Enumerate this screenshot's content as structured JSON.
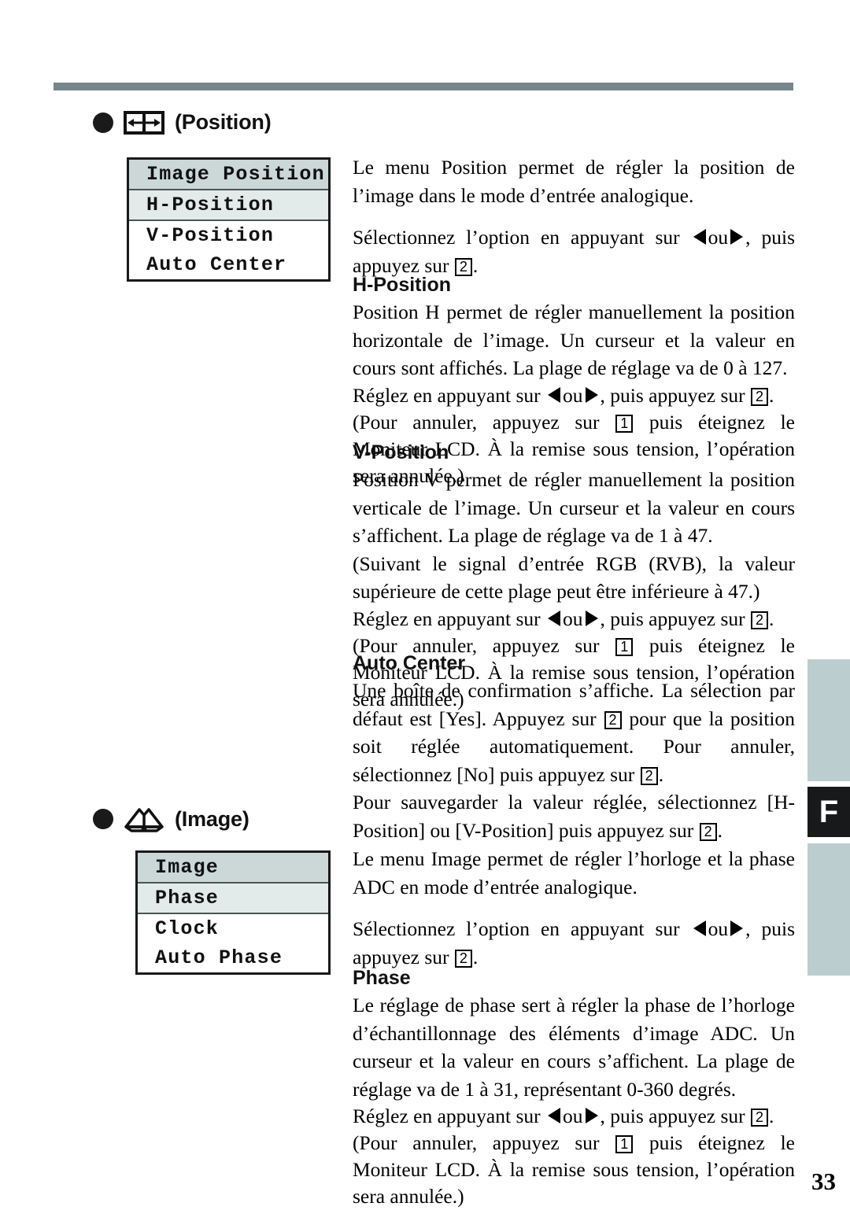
{
  "page": {
    "number": "33",
    "tab_letter": "F",
    "rule_color": "#76868a",
    "tab_color": "#bccdcf",
    "tab_active_color": "#17191b"
  },
  "sections": [
    {
      "icon": "position-icon",
      "heading": "(Position)",
      "osd": {
        "rows": [
          {
            "label": "Image Position",
            "state": "title"
          },
          {
            "label": "H-Position",
            "state": "selected"
          },
          {
            "label": "V-Position",
            "state": "normal"
          },
          {
            "label": "Auto Center",
            "state": "normal"
          }
        ]
      },
      "intro": [
        "Le menu Position permet de régler la position de l’image dans le mode d’entrée analogique.",
        "Sélectionnez l’option en appuyant sur "
      ],
      "intro_tail": ", puis appuyez sur ",
      "subsections": [
        {
          "title": "H-Position",
          "body": "Position H permet de régler manuellement la position horizontale de l’image. Un curseur et la valeur en cours sont affichés. La plage de réglage va de 0 à 127.",
          "adjust_lead": "Réglez en appuyant sur ",
          "adjust_mid": ",  puis appuyez sur ",
          "cancel_lead": "(Pour annuler, appuyez sur ",
          "cancel_tail": " puis éteignez le Moniteur LCD. À la remise sous tension, l’opération sera annulée.)"
        },
        {
          "title": "V-Position",
          "body": "Position V permet de régler manuellement la position verticale de l’image. Un curseur et la valeur en cours s’affichent. La plage de réglage va de 1 à 47.",
          "note": "(Suivant le signal d’entrée RGB (RVB), la valeur supérieure de cette plage peut être inférieure à 47.)",
          "adjust_lead": "Réglez en appuyant sur ",
          "adjust_mid": ",  puis appuyez sur ",
          "cancel_lead": "(Pour annuler, appuyez sur ",
          "cancel_tail": " puis éteignez le Moniteur LCD. À la remise sous tension, l’opération sera annulée.)"
        },
        {
          "title": "Auto Center",
          "body_a": "Une boîte de confirmation s’affiche. La sélection par défaut est [Yes]. Appuyez sur ",
          "body_b": " pour que la position soit réglée automatiquement. Pour annuler, sélectionnez [No] puis appuyez sur ",
          "body_c": ".",
          "save_a": "Pour sauvegarder la valeur réglée, sélectionnez [H-Position] ou [V-Position] puis appuyez sur ",
          "save_b": "."
        }
      ]
    },
    {
      "icon": "image-icon",
      "heading": "(Image)",
      "osd": {
        "rows": [
          {
            "label": "Image",
            "state": "title"
          },
          {
            "label": "Phase",
            "state": "selected"
          },
          {
            "label": "Clock",
            "state": "normal"
          },
          {
            "label": "Auto Phase",
            "state": "normal"
          }
        ]
      },
      "intro": [
        "Le menu Image permet de régler l’horloge et la phase ADC en mode d’entrée analogique.",
        "Sélectionnez l’option en appuyant sur "
      ],
      "intro_tail": ",  puis appuyez sur ",
      "subsections": [
        {
          "title": "Phase",
          "body": "Le réglage de phase sert à régler la phase de l’horloge d’échantillonnage des éléments d’image ADC. Un curseur et la valeur en cours s’affichent. La plage de réglage va de 1 à 31, représentant 0-360 degrés.",
          "adjust_lead": "Réglez en appuyant sur ",
          "adjust_mid": ",  puis appuyez sur ",
          "cancel_lead": "(Pour annuler, appuyez sur ",
          "cancel_tail": " puis éteignez le Moniteur LCD. À la remise sous tension, l’opération sera annulée.)"
        }
      ]
    }
  ],
  "keys": {
    "enter": "2",
    "escape": "1",
    "ou": "ou",
    "period": "."
  }
}
